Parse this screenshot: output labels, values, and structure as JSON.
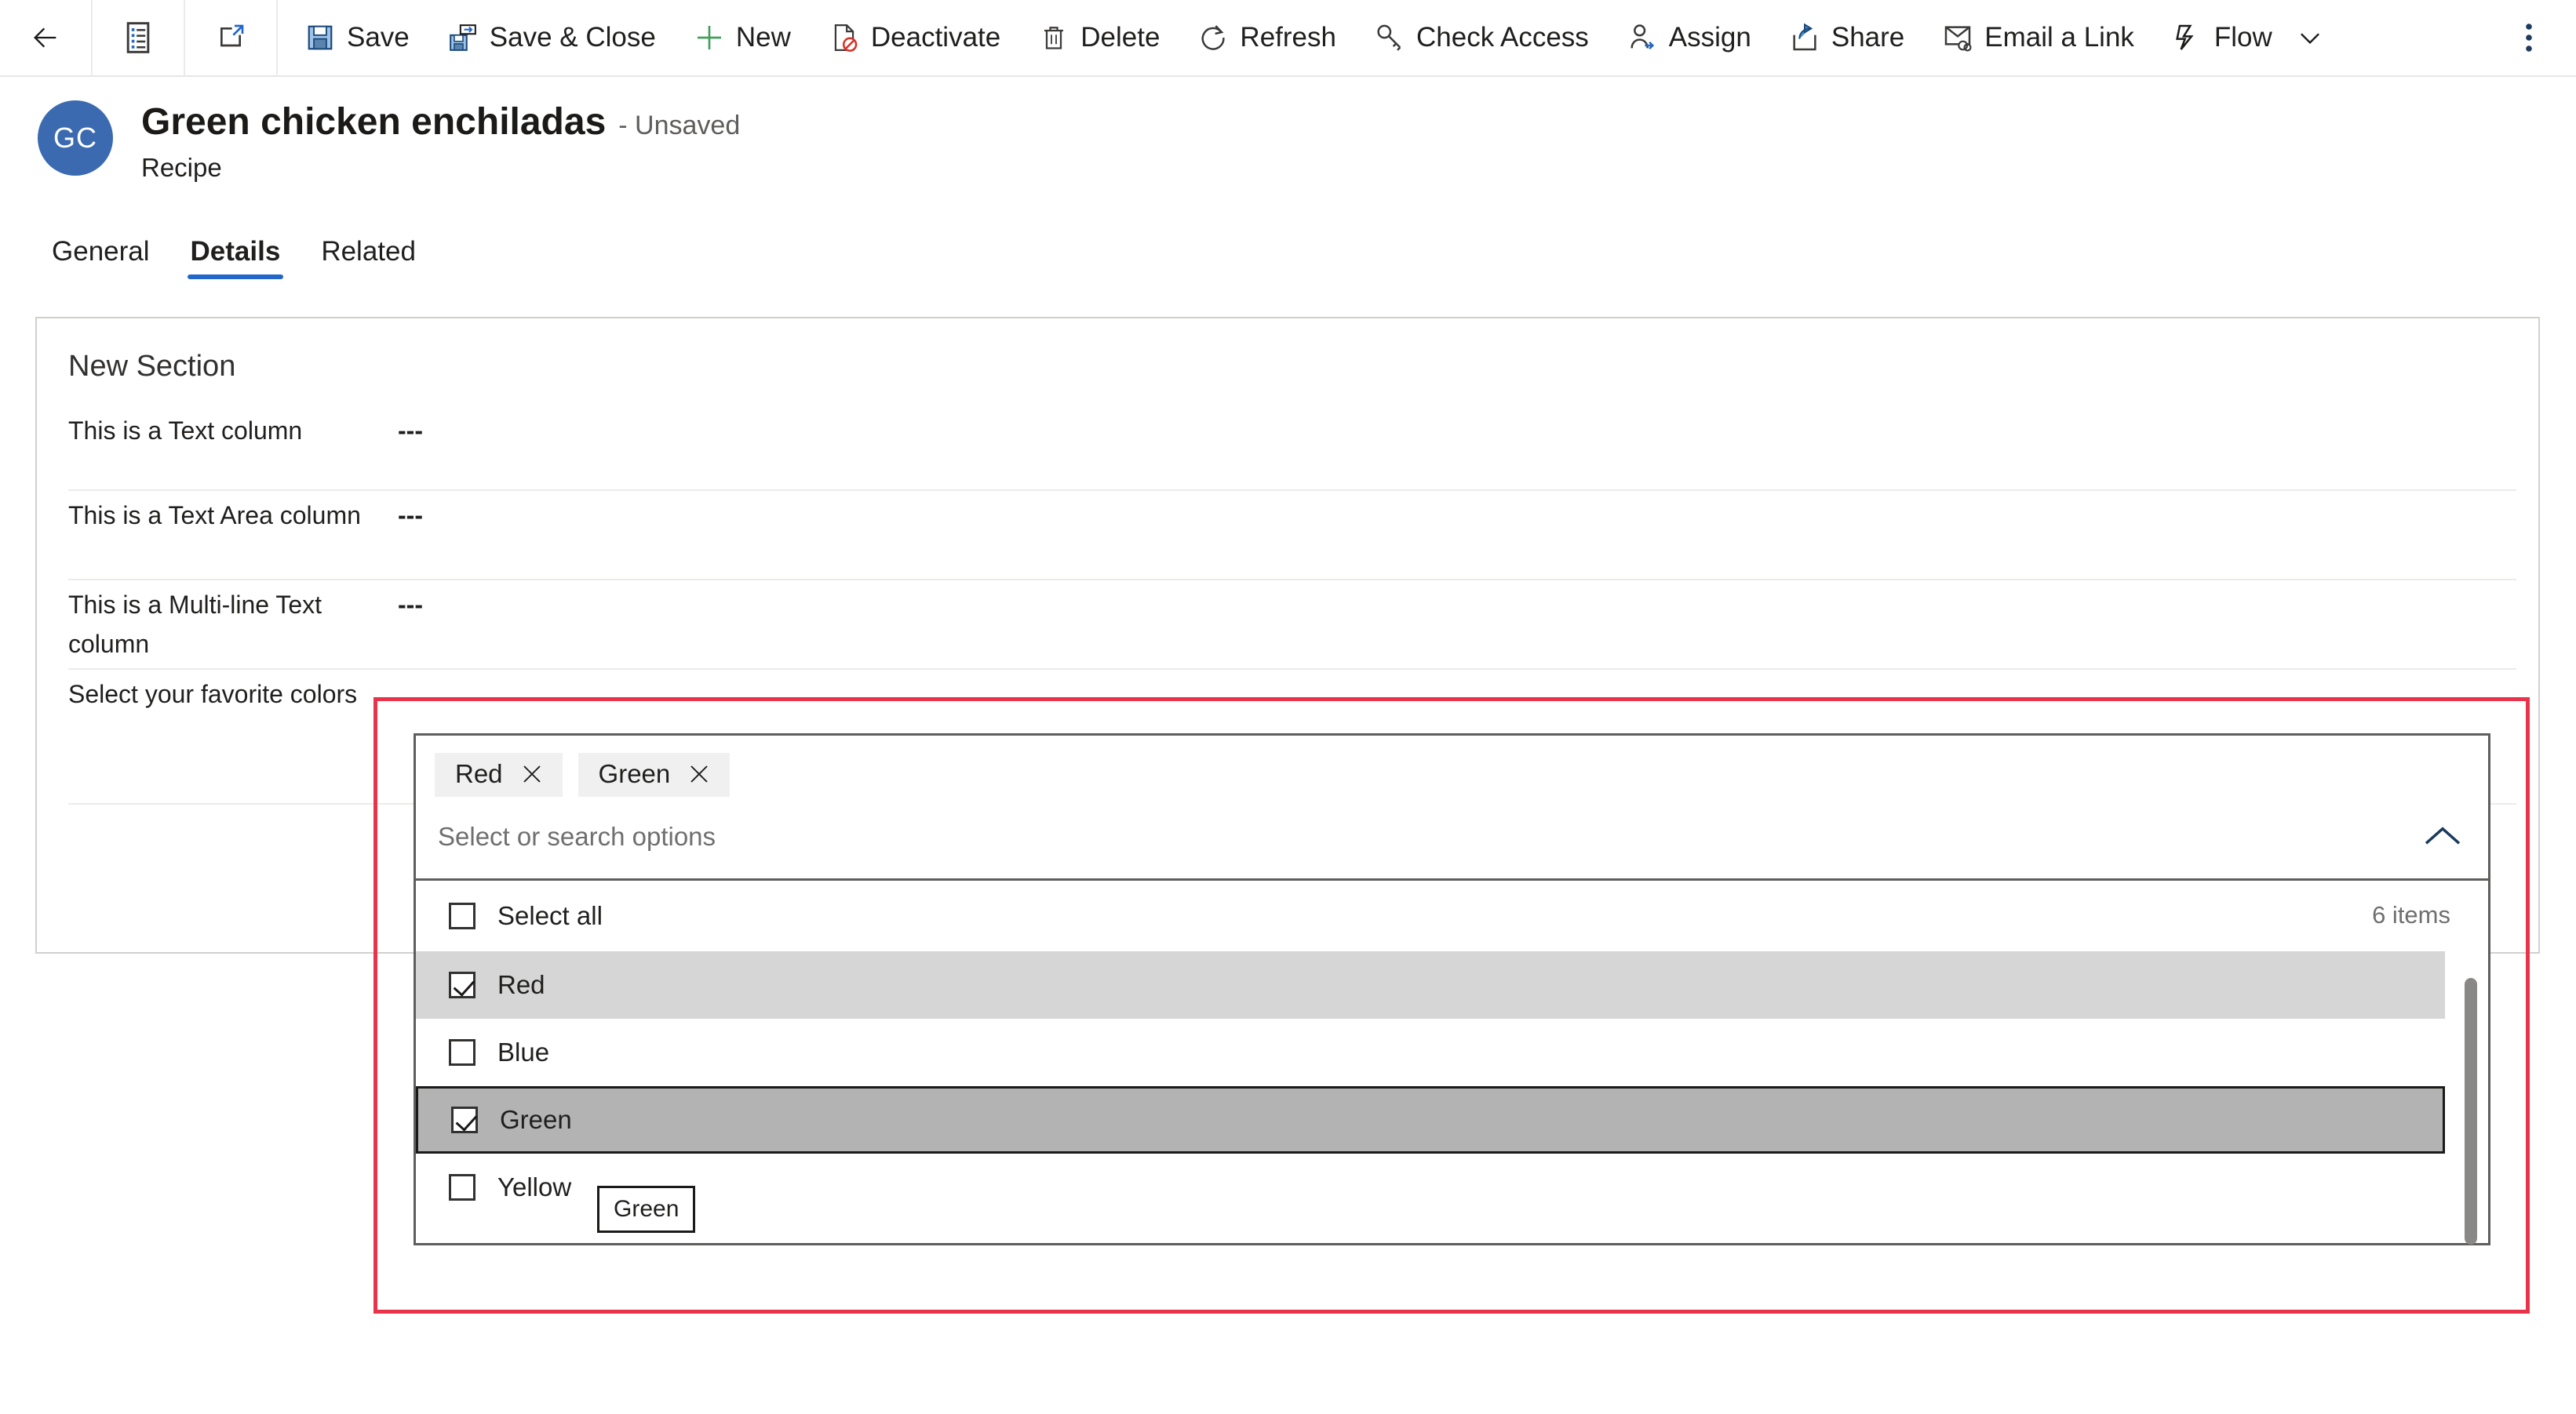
{
  "commandbar": {
    "groups": [
      {
        "buttons": [
          {
            "label": "",
            "icon": "back-arrow-icon",
            "name": "back-button"
          }
        ]
      },
      {
        "buttons": [
          {
            "label": "",
            "icon": "form-selector-icon",
            "name": "form-selector-button"
          }
        ]
      },
      {
        "buttons": [
          {
            "label": "",
            "icon": "popout-icon",
            "name": "open-in-new-window-button"
          }
        ]
      }
    ],
    "actions": [
      {
        "label": "Save",
        "icon": "save-icon",
        "name": "save-button"
      },
      {
        "label": "Save & Close",
        "icon": "save-and-close-icon",
        "name": "save-and-close-button"
      },
      {
        "label": "New",
        "icon": "plus-icon",
        "name": "new-button"
      },
      {
        "label": "Deactivate",
        "icon": "deactivate-icon",
        "name": "deactivate-button"
      },
      {
        "label": "Delete",
        "icon": "trash-icon",
        "name": "delete-button"
      },
      {
        "label": "Refresh",
        "icon": "refresh-icon",
        "name": "refresh-button"
      },
      {
        "label": "Check Access",
        "icon": "key-icon",
        "name": "check-access-button"
      },
      {
        "label": "Assign",
        "icon": "assign-person-icon",
        "name": "assign-button"
      },
      {
        "label": "Share",
        "icon": "share-icon",
        "name": "share-button"
      },
      {
        "label": "Email a Link",
        "icon": "email-link-icon",
        "name": "email-a-link-button"
      },
      {
        "label": "Flow",
        "icon": "flow-icon",
        "name": "flow-button"
      }
    ],
    "flow_caret": "chevron-down-icon",
    "overflow": "more-commands-icon"
  },
  "record": {
    "avatar_initials": "GC",
    "title": "Green chicken enchiladas",
    "unsaved_label": "- Unsaved",
    "entity_name": "Recipe"
  },
  "tabs": [
    {
      "label": "General",
      "active": false
    },
    {
      "label": "Details",
      "active": true
    },
    {
      "label": "Related",
      "active": false
    }
  ],
  "form": {
    "section_title": "New Section",
    "fields": [
      {
        "label": "This is a Text column",
        "value": "---"
      },
      {
        "label": "This is a Text Area column",
        "value": "---"
      },
      {
        "label": "This is a Multi-line Text column",
        "value": "---"
      },
      {
        "label": "Select your favorite colors",
        "value": ""
      }
    ]
  },
  "multiselect": {
    "selected_chips": [
      {
        "label": "Red",
        "remove_icon": "close-icon"
      },
      {
        "label": "Green",
        "remove_icon": "close-icon"
      }
    ],
    "placeholder": "Select or search options",
    "search_value": "",
    "expand_icon": "chevron-up-icon",
    "select_all_label": "Select all",
    "select_all_checked": false,
    "item_count_label": "6 items",
    "options": [
      {
        "label": "Red",
        "checked": true,
        "state": "selected"
      },
      {
        "label": "Blue",
        "checked": false,
        "state": "normal"
      },
      {
        "label": "Green",
        "checked": true,
        "state": "focused"
      },
      {
        "label": "Yellow",
        "checked": false,
        "state": "normal"
      }
    ],
    "tooltip_text": "Green"
  },
  "colors": {
    "accent": "#2266c9",
    "avatar": "#3b6ab1",
    "highlight_border": "#e8334a",
    "chip_bg": "#f0f0f0",
    "selected_row": "#d6d6d6",
    "focused_row": "#b3b3b3"
  }
}
